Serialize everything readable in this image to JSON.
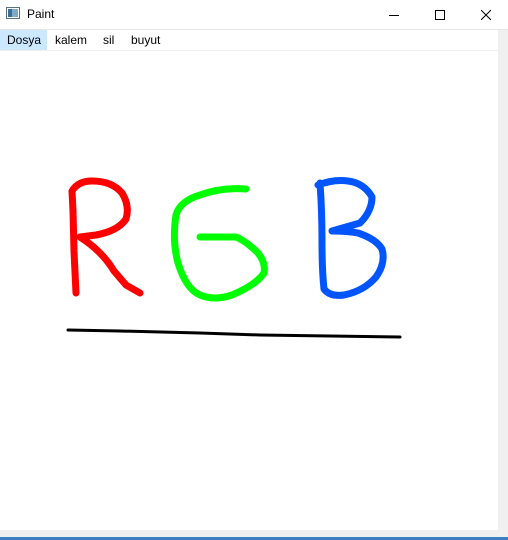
{
  "window": {
    "title": "Paint",
    "controls": {
      "minimize_icon": "minimize-icon",
      "maximize_icon": "maximize-icon",
      "close_icon": "close-icon"
    }
  },
  "menu": {
    "items": [
      {
        "label": "Dosya",
        "active": true
      },
      {
        "label": "kalem",
        "active": false
      },
      {
        "label": "sil",
        "active": false
      },
      {
        "label": "buyut",
        "active": false
      }
    ]
  },
  "drawing": {
    "strokes": [
      {
        "name": "letter-r-stroke",
        "color": "#ff0000"
      },
      {
        "name": "letter-g-stroke",
        "color": "#00ff00"
      },
      {
        "name": "letter-b-stroke",
        "color": "#0055ff"
      },
      {
        "name": "underline-stroke",
        "color": "#000000"
      }
    ]
  },
  "colors": {
    "menu_highlight": "#cce8ff",
    "accent": "#3a7fc4"
  }
}
